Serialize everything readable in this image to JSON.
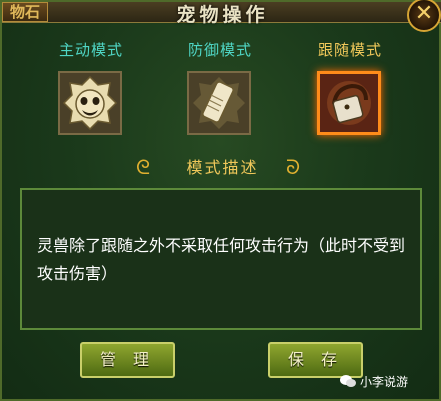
{
  "window": {
    "title": "宠物操作",
    "corner_tag": "物石",
    "close_label": "✕"
  },
  "modes": [
    {
      "label": "主动模式",
      "icon": "lion-face-icon",
      "selected": false
    },
    {
      "label": "防御模式",
      "icon": "scroll-icon",
      "selected": false
    },
    {
      "label": "跟随模式",
      "icon": "follow-bag-icon",
      "selected": true
    }
  ],
  "description": {
    "heading": "模式描述",
    "text": "灵兽除了跟随之外不采取任何攻击行为（此时不受到攻击伤害）"
  },
  "buttons": {
    "manage": "管 理",
    "save": "保 存"
  },
  "watermark": "小李说游",
  "colors": {
    "mode_label": "#4fd6c5",
    "selected_label": "#f0c85a",
    "selected_border": "#ff8c1a"
  }
}
